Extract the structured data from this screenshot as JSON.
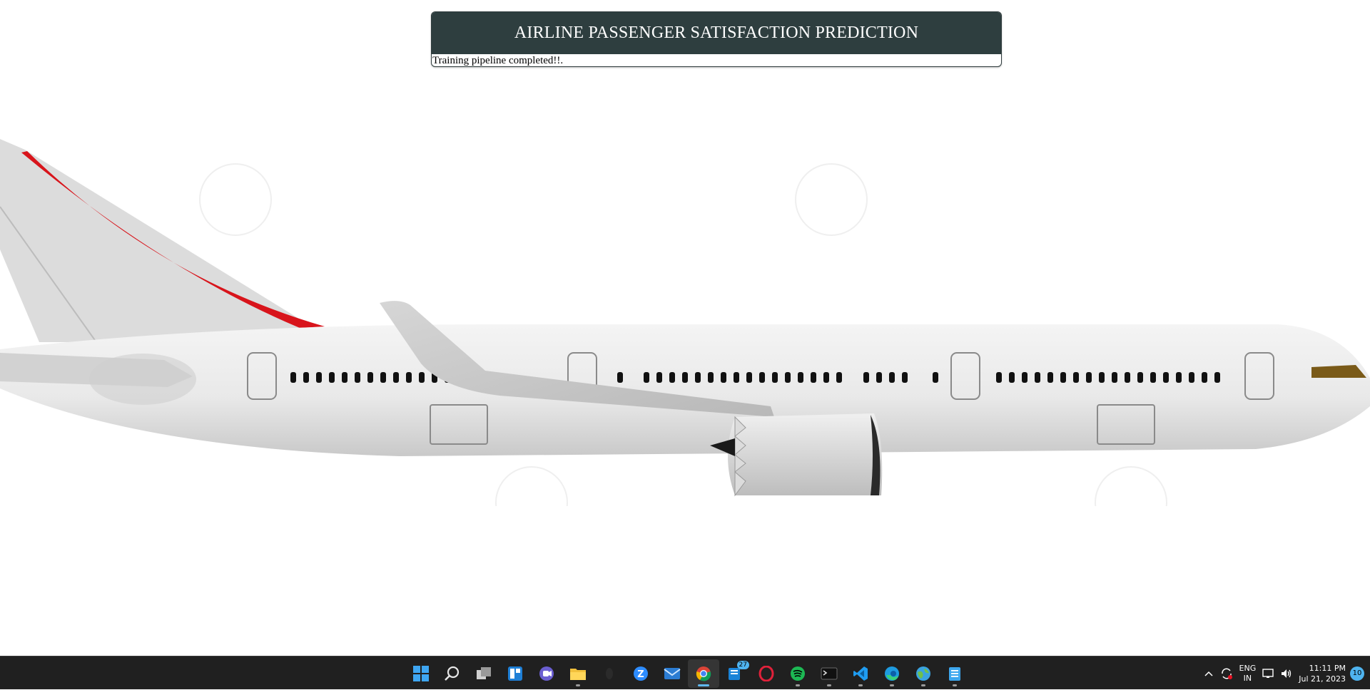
{
  "page": {
    "title": "AIRLINE PASSENGER SATISFACTION PREDICTION",
    "message": "Training pipeline completed!!."
  },
  "taskbar": {
    "apps": [
      {
        "name": "windows-start-icon"
      },
      {
        "name": "search-icon"
      },
      {
        "name": "task-view-icon"
      },
      {
        "name": "widgets-icon"
      },
      {
        "name": "teams-chat-icon"
      },
      {
        "name": "file-explorer-icon"
      },
      {
        "name": "app-icon"
      },
      {
        "name": "zoom-icon"
      },
      {
        "name": "mail-icon"
      },
      {
        "name": "chrome-icon"
      },
      {
        "name": "news-icon",
        "badge": "27"
      },
      {
        "name": "opera-icon"
      },
      {
        "name": "spotify-icon"
      },
      {
        "name": "terminal-icon"
      },
      {
        "name": "vscode-icon"
      },
      {
        "name": "edge-icon"
      },
      {
        "name": "maps-icon"
      },
      {
        "name": "notepad-icon"
      }
    ],
    "lang_top": "ENG",
    "lang_bottom": "IN",
    "time": "11:11 PM",
    "date": "Jul 21, 2023",
    "notifications": "10",
    "colors": {
      "bar": "#202020",
      "accent": "#4fb4f0",
      "header": "#2e3e3f"
    }
  }
}
